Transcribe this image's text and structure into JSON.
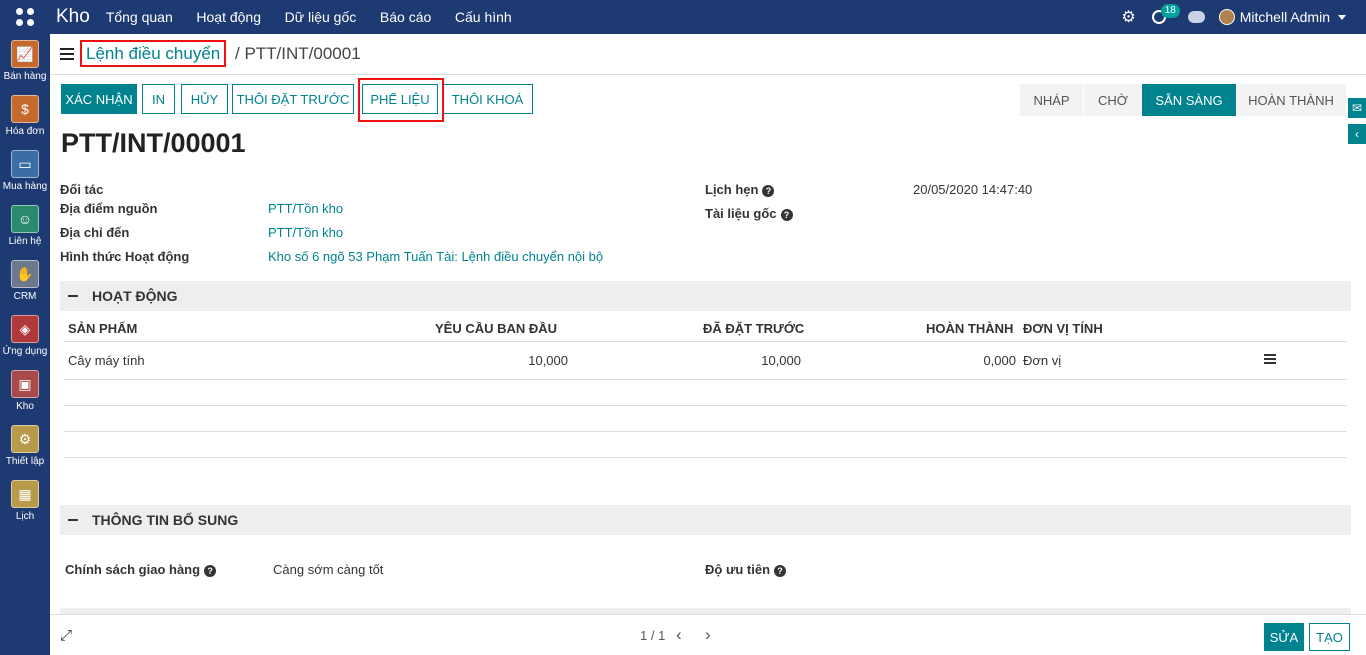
{
  "topbar": {
    "brand": "Kho",
    "menu": [
      "Tổng quan",
      "Hoạt động",
      "Dữ liệu gốc",
      "Báo cáo",
      "Cấu hình"
    ],
    "notification_count": "18",
    "user_name": "Mitchell Admin"
  },
  "sidebar": {
    "items": [
      {
        "label": "Bán hàng",
        "icon": "chart-icon"
      },
      {
        "label": "Hóa đơn",
        "icon": "invoice-icon"
      },
      {
        "label": "Mua hàng",
        "icon": "card-icon"
      },
      {
        "label": "Liên hệ",
        "icon": "contact-icon"
      },
      {
        "label": "CRM",
        "icon": "handshake-icon"
      },
      {
        "label": "Ứng dụng",
        "icon": "cubes-icon"
      },
      {
        "label": "Kho",
        "icon": "box-icon"
      },
      {
        "label": "Thiết lập",
        "icon": "gear-icon"
      },
      {
        "label": "Lịch",
        "icon": "calendar-icon"
      }
    ]
  },
  "breadcrumb": {
    "parent": "Lệnh điều chuyển",
    "separator": "/",
    "current": "PTT/INT/00001"
  },
  "buttons": {
    "confirm": "XÁC NHẬN",
    "print": "IN",
    "cancel": "HỦY",
    "unreserve": "THÔI ĐẶT TRƯỚC",
    "scrap": "PHẾ LIỆU",
    "unlock": "THÔI KHOÁ"
  },
  "statusbar": {
    "stages": [
      "NHÁP",
      "CHỜ",
      "SẴN SÀNG",
      "HOÀN THÀNH"
    ],
    "active": "SẴN SÀNG"
  },
  "record": {
    "title": "PTT/INT/00001",
    "partner_label": "Đối tác",
    "source_label": "Địa điểm nguồn",
    "source_value": "PTT/Tồn kho",
    "dest_label": "Địa chỉ đến",
    "dest_value": "PTT/Tồn kho",
    "optype_label": "Hình thức Hoạt động",
    "optype_value": "Kho số 6 ngõ 53 Phạm Tuấn Tài: Lệnh điều chuyển nội bộ",
    "scheduled_label": "Lịch hẹn",
    "scheduled_value": "20/05/2020 14:47:40",
    "origin_label": "Tài liệu gốc"
  },
  "operations": {
    "section_title": "HOẠT ĐỘNG",
    "headers": [
      "SẢN PHẨM",
      "YÊU CẦU BAN ĐẦU",
      "ĐÃ ĐẶT TRƯỚC",
      "HOÀN THÀNH",
      "ĐƠN VỊ TÍNH"
    ],
    "rows": [
      [
        "Cây máy tính",
        "10,000",
        "10,000",
        "0,000",
        "Đơn vị"
      ]
    ]
  },
  "additional": {
    "section_title": "THÔNG TIN BỔ SUNG",
    "policy_label": "Chính sách giao hàng",
    "policy_value": "Càng sớm càng tốt",
    "priority_label": "Độ ưu tiên"
  },
  "pager": {
    "value": "1 / 1",
    "edit": "SỬA",
    "create": "TẠO"
  }
}
